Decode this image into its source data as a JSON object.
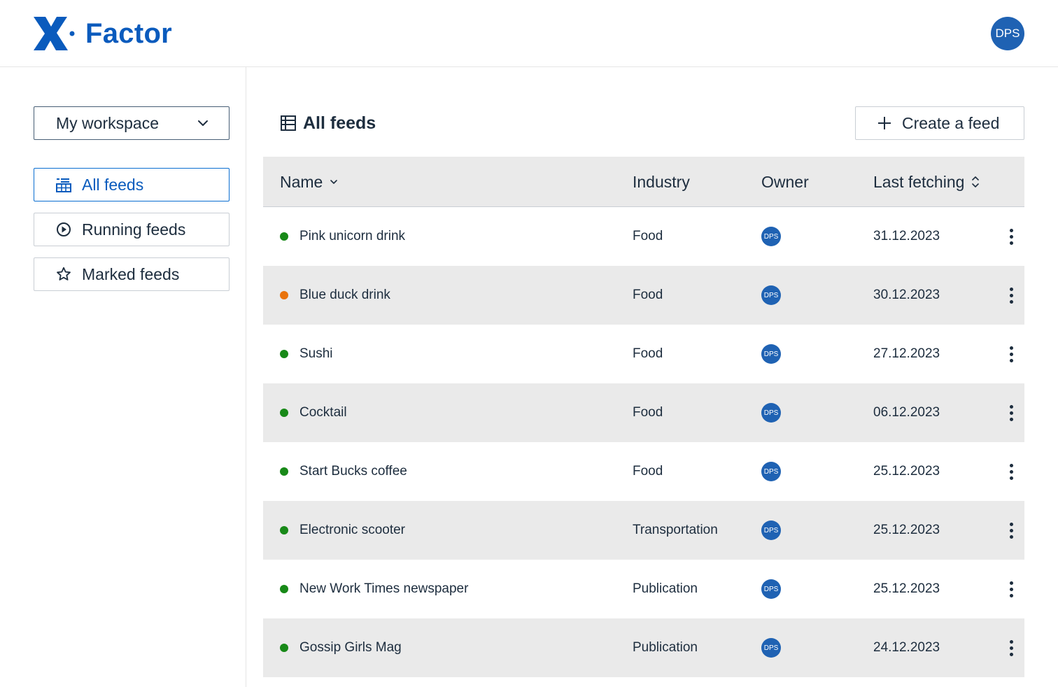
{
  "app": {
    "logo_text": "Factor",
    "brand_color": "#0a5bbd",
    "user_initials": "DPS"
  },
  "sidebar": {
    "workspace_label": "My workspace",
    "items": [
      {
        "label": "All feeds",
        "icon": "table-list-icon",
        "active": true
      },
      {
        "label": "Running feeds",
        "icon": "play-circle-icon",
        "active": false
      },
      {
        "label": "Marked feeds",
        "icon": "star-icon",
        "active": false
      }
    ]
  },
  "main": {
    "title": "All feeds",
    "create_label": "Create a feed"
  },
  "table": {
    "columns": {
      "name": "Name",
      "industry": "Industry",
      "owner": "Owner",
      "last_fetching": "Last fetching"
    },
    "status_colors": {
      "ok": "#188918",
      "warning": "#e9730c"
    },
    "rows": [
      {
        "status": "ok",
        "name": "Pink unicorn drink",
        "industry": "Food",
        "owner": "DPS",
        "date": "31.12.2023"
      },
      {
        "status": "warning",
        "name": "Blue duck drink",
        "industry": "Food",
        "owner": "DPS",
        "date": "30.12.2023"
      },
      {
        "status": "ok",
        "name": "Sushi",
        "industry": "Food",
        "owner": "DPS",
        "date": "27.12.2023"
      },
      {
        "status": "ok",
        "name": "Cocktail",
        "industry": "Food",
        "owner": "DPS",
        "date": "06.12.2023"
      },
      {
        "status": "ok",
        "name": "Start Bucks coffee",
        "industry": "Food",
        "owner": "DPS",
        "date": "25.12.2023"
      },
      {
        "status": "ok",
        "name": "Electronic scooter",
        "industry": "Transportation",
        "owner": "DPS",
        "date": "25.12.2023"
      },
      {
        "status": "ok",
        "name": "New Work Times newspaper",
        "industry": "Publication",
        "owner": "DPS",
        "date": "25.12.2023"
      },
      {
        "status": "ok",
        "name": "Gossip Girls Mag",
        "industry": "Publication",
        "owner": "DPS",
        "date": "24.12.2023"
      }
    ]
  }
}
